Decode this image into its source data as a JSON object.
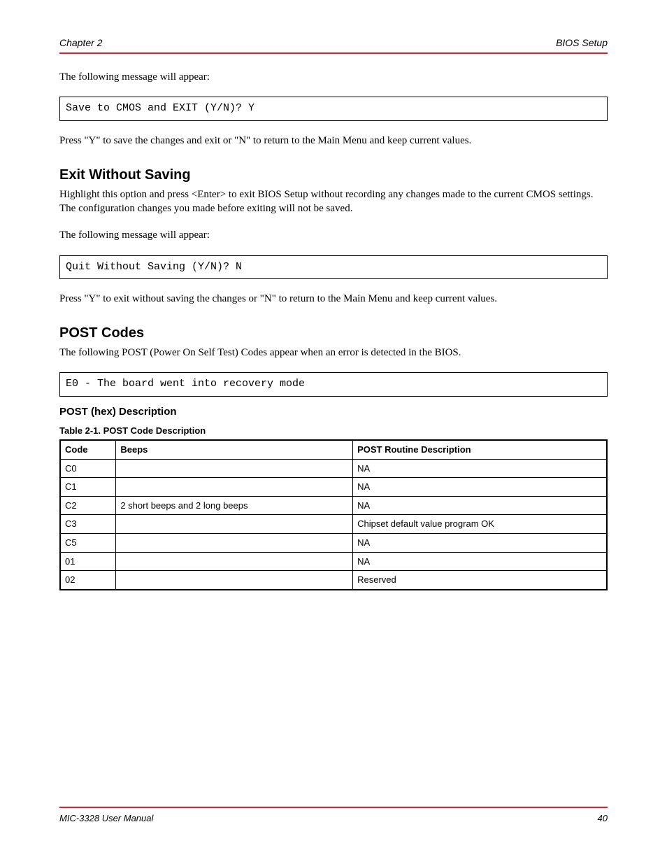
{
  "header": {
    "left": "Chapter 2",
    "right": "BIOS Setup"
  },
  "p1": "The following message will appear:",
  "code1": "Save to CMOS and EXIT (Y/N)? Y",
  "p2": "Press \"Y\" to save the changes and exit or \"N\" to return to the Main Menu and keep current values.",
  "sect_exit": "Exit Without Saving",
  "p3": "Highlight this option and press <Enter> to exit BIOS Setup without recording any changes made to the current CMOS settings. The configuration changes you made before exiting will not be saved.",
  "p4": "The following message will appear:",
  "code2": "Quit Without Saving (Y/N)? N",
  "p5": "Press \"Y\" to exit without saving the changes or \"N\" to return to the Main Menu and keep current values.",
  "sect_post": "POST Codes",
  "p6": "The following POST (Power On Self Test) Codes appear when an error is detected in the BIOS.",
  "code3": "E0 - The board went into recovery mode",
  "subsect": "POST (hex) Description",
  "tcap": "Table 2-1. POST Code Description",
  "table": {
    "headers": [
      "Code",
      "Beeps",
      "POST Routine Description"
    ],
    "rows": [
      [
        "C0",
        "",
        "NA"
      ],
      [
        "C1",
        "",
        "NA"
      ],
      [
        "C2",
        "2 short beeps and 2 long beeps",
        "NA"
      ],
      [
        "C3",
        "",
        "Chipset default value program OK"
      ],
      [
        "C5",
        "",
        "NA"
      ],
      [
        "01",
        "",
        "NA"
      ],
      [
        "02",
        "",
        "Reserved"
      ]
    ]
  },
  "footer": {
    "left": "MIC-3328 User Manual",
    "right": "40"
  }
}
